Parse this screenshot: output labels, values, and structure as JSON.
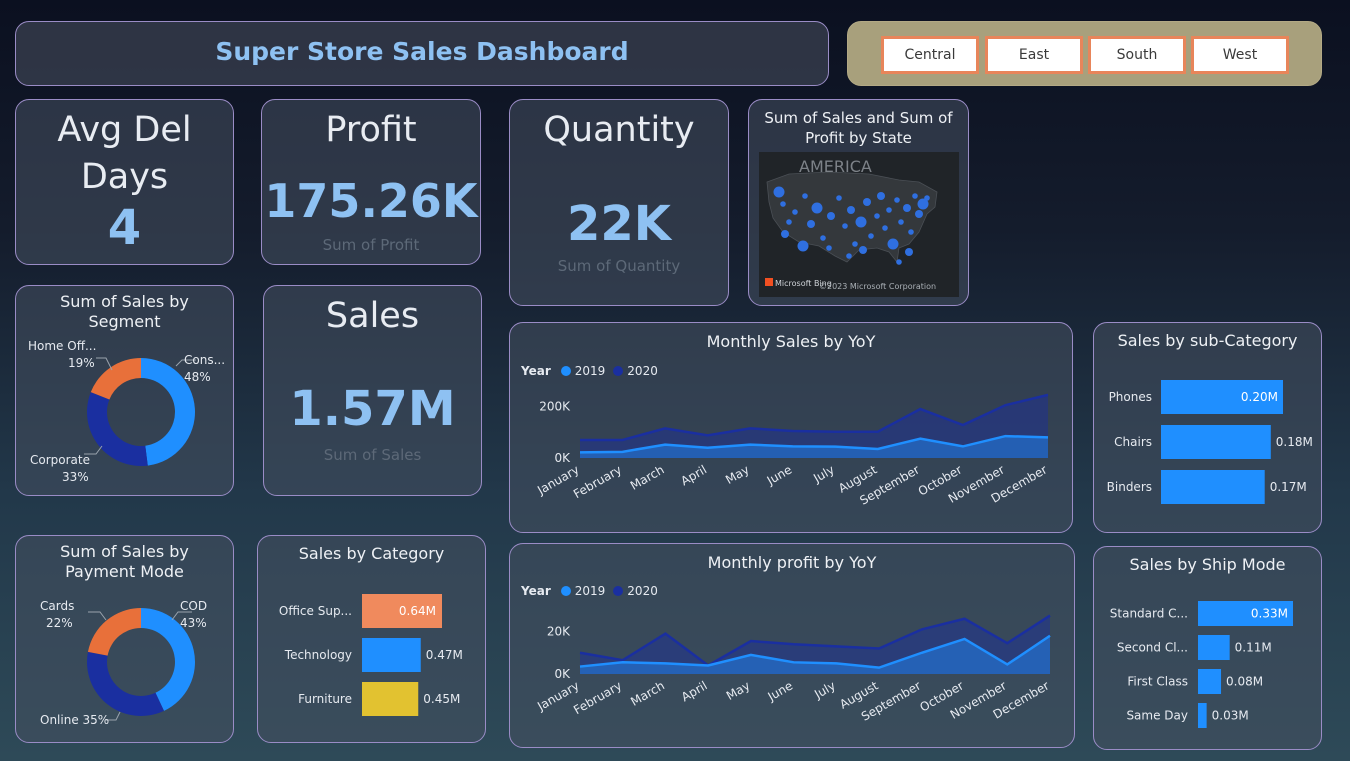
{
  "header": {
    "title": "Super Store Sales Dashboard"
  },
  "slicer": {
    "items": [
      "Central",
      "East",
      "South",
      "West"
    ]
  },
  "kpis": {
    "avg_del": {
      "title_line1": "Avg Del",
      "title_line2": "Days",
      "value": "4"
    },
    "profit": {
      "title": "Profit",
      "value": "175.26K",
      "sub": "Sum of Profit"
    },
    "quantity": {
      "title": "Quantity",
      "value": "22K",
      "sub": "Sum of Quantity"
    },
    "sales": {
      "title": "Sales",
      "value": "1.57M",
      "sub": "Sum of Sales"
    }
  },
  "map": {
    "title": "Sum of Sales and Sum of Profit by State",
    "region_label": "AMERICA",
    "brand": "Microsoft Bing",
    "copyright": "©2023 Microsoft Corporation"
  },
  "colors": {
    "y2019": "#1f8fff",
    "y2020": "#1a2fa0",
    "orange": "#e8703a",
    "light_orange": "#f08a5d",
    "yellow": "#e2c230",
    "bar_blue": "#1f8fff"
  },
  "segment_chart": {
    "title": "Sum of Sales by Segment",
    "labels": [
      {
        "name": "Cons...",
        "pct": "48%"
      },
      {
        "name": "Corporate",
        "pct": "33%"
      },
      {
        "name": "Home Off...",
        "pct": "19%"
      }
    ],
    "chart_data": {
      "type": "pie",
      "categories": [
        "Consumer",
        "Corporate",
        "Home Office"
      ],
      "values": [
        48,
        33,
        19
      ]
    }
  },
  "payment_chart": {
    "title": "Sum of Sales by Payment Mode",
    "labels": [
      {
        "name": "COD",
        "pct": "43%"
      },
      {
        "name": "Online 35%",
        "pct": ""
      },
      {
        "name": "Cards",
        "pct": "22%"
      }
    ],
    "chart_data": {
      "type": "pie",
      "categories": [
        "COD",
        "Online",
        "Cards"
      ],
      "values": [
        43,
        35,
        22
      ]
    }
  },
  "category_chart": {
    "title": "Sales by Category",
    "chart_data": {
      "type": "bar",
      "categories": [
        "Office Sup...",
        "Technology",
        "Furniture"
      ],
      "values": [
        0.64,
        0.47,
        0.45
      ],
      "labels": [
        "0.64M",
        "0.47M",
        "0.45M"
      ]
    }
  },
  "subcat_chart": {
    "title": "Sales by sub-Category",
    "chart_data": {
      "type": "bar",
      "categories": [
        "Phones",
        "Chairs",
        "Binders"
      ],
      "values": [
        0.2,
        0.18,
        0.17
      ],
      "labels": [
        "0.20M",
        "0.18M",
        "0.17M"
      ]
    }
  },
  "ship_chart": {
    "title": "Sales by Ship Mode",
    "chart_data": {
      "type": "bar",
      "categories": [
        "Standard C...",
        "Second Cl...",
        "First Class",
        "Same Day"
      ],
      "values": [
        0.33,
        0.11,
        0.08,
        0.03
      ],
      "labels": [
        "0.33M",
        "0.11M",
        "0.08M",
        "0.03M"
      ]
    }
  },
  "monthly_sales": {
    "title": "Monthly Sales by YoY",
    "legend_title": "Year",
    "y_ticks": [
      "200K",
      "0K"
    ],
    "chart_data": {
      "type": "area",
      "categories": [
        "January",
        "February",
        "March",
        "April",
        "May",
        "June",
        "July",
        "August",
        "September",
        "October",
        "November",
        "December"
      ],
      "ylim": [
        0,
        260000
      ],
      "series": [
        {
          "name": "2019",
          "values": [
            22000,
            24000,
            52000,
            40000,
            52000,
            45000,
            44000,
            35000,
            75000,
            45000,
            85000,
            80000
          ]
        },
        {
          "name": "2020",
          "values": [
            70000,
            70000,
            115000,
            88000,
            115000,
            105000,
            102000,
            102000,
            190000,
            128000,
            205000,
            245000
          ]
        }
      ]
    }
  },
  "monthly_profit": {
    "title": "Monthly profit by YoY",
    "legend_title": "Year",
    "y_ticks": [
      "20K",
      "0K"
    ],
    "chart_data": {
      "type": "area",
      "categories": [
        "January",
        "February",
        "March",
        "April",
        "May",
        "June",
        "July",
        "August",
        "September",
        "October",
        "November",
        "December"
      ],
      "ylim": [
        0,
        32000
      ],
      "series": [
        {
          "name": "2019",
          "values": [
            3500,
            5500,
            5000,
            4000,
            9000,
            5500,
            5000,
            3000,
            10000,
            16500,
            4500,
            18000
          ]
        },
        {
          "name": "2020",
          "values": [
            10000,
            6500,
            19000,
            4000,
            15500,
            14000,
            13000,
            12000,
            21000,
            26000,
            14500,
            27500
          ]
        }
      ]
    }
  }
}
